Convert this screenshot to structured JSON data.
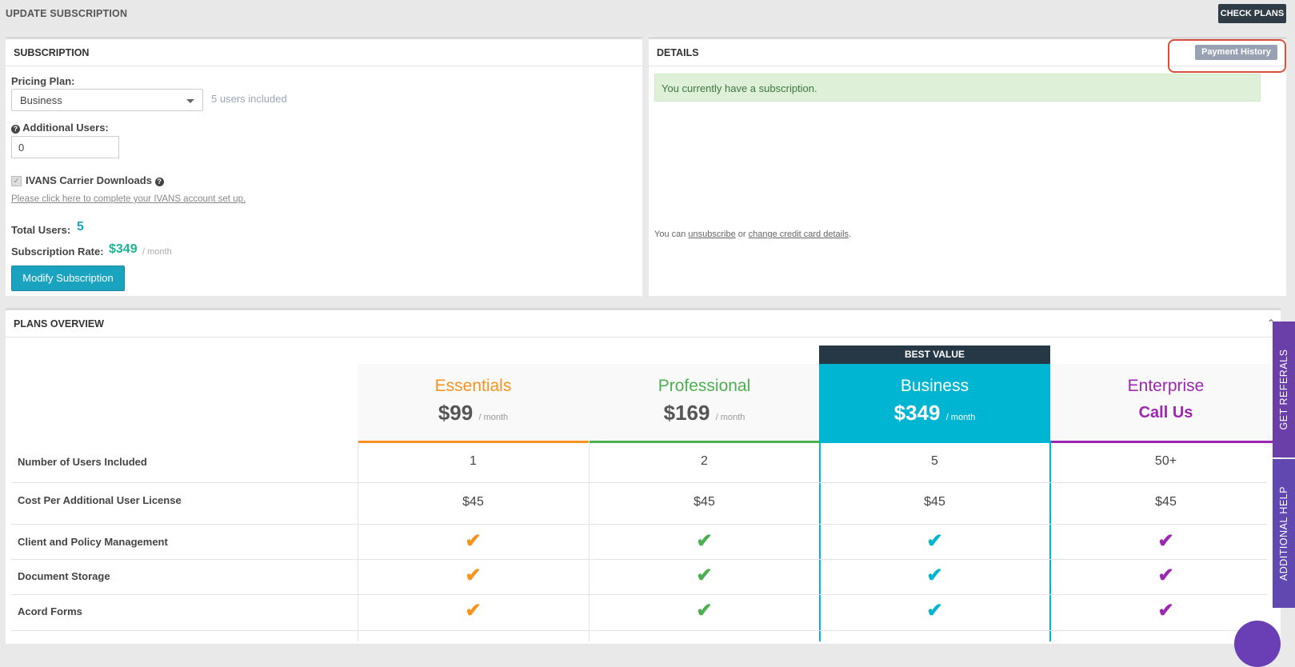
{
  "header": {
    "title": "UPDATE SUBSCRIPTION",
    "check_plans": "CHECK PLANS"
  },
  "subscription": {
    "title": "SUBSCRIPTION",
    "pricing_plan_label": "Pricing Plan:",
    "pricing_plan_value": "Business",
    "users_included": "5 users included",
    "additional_users_label": "Additional Users:",
    "additional_users_value": "0",
    "ivans_label": "IVANS Carrier Downloads",
    "ivans_link": "Please click here to complete your IVANS account set up.",
    "total_users_label": "Total Users:",
    "total_users_value": "5",
    "rate_label": "Subscription Rate:",
    "rate_value": "$349",
    "rate_unit": "/ month",
    "modify_button": "Modify Subscription"
  },
  "details": {
    "title": "DETAILS",
    "payment_history": "Payment History",
    "alert": "You currently have a subscription.",
    "note_prefix": "You can ",
    "unsubscribe": "unsubscribe",
    "note_mid": " or ",
    "change_card": "change credit card details",
    "note_suffix": "."
  },
  "plans": {
    "title": "PLANS OVERVIEW",
    "best_value": "BEST VALUE",
    "per_month": "/ month",
    "columns": [
      {
        "name": "Essentials",
        "price": "$99",
        "color": "#f7931e"
      },
      {
        "name": "Professional",
        "price": "$169",
        "color": "#4caf50"
      },
      {
        "name": "Business",
        "price": "$349",
        "color": "#00b5d1"
      },
      {
        "name": "Enterprise",
        "price": "Call Us",
        "color": "#9c27b0"
      }
    ],
    "rows": [
      {
        "label": "Number of Users Included",
        "values": [
          "1",
          "2",
          "5",
          "50+"
        ]
      },
      {
        "label": "Cost Per Additional User License",
        "values": [
          "$45",
          "$45",
          "$45",
          "$45"
        ]
      },
      {
        "label": "Client and Policy Management"
      },
      {
        "label": "Document Storage"
      },
      {
        "label": "Acord Forms"
      }
    ]
  },
  "side": {
    "referrals": "GET REFERALS",
    "help": "ADDITIONAL HELP"
  }
}
